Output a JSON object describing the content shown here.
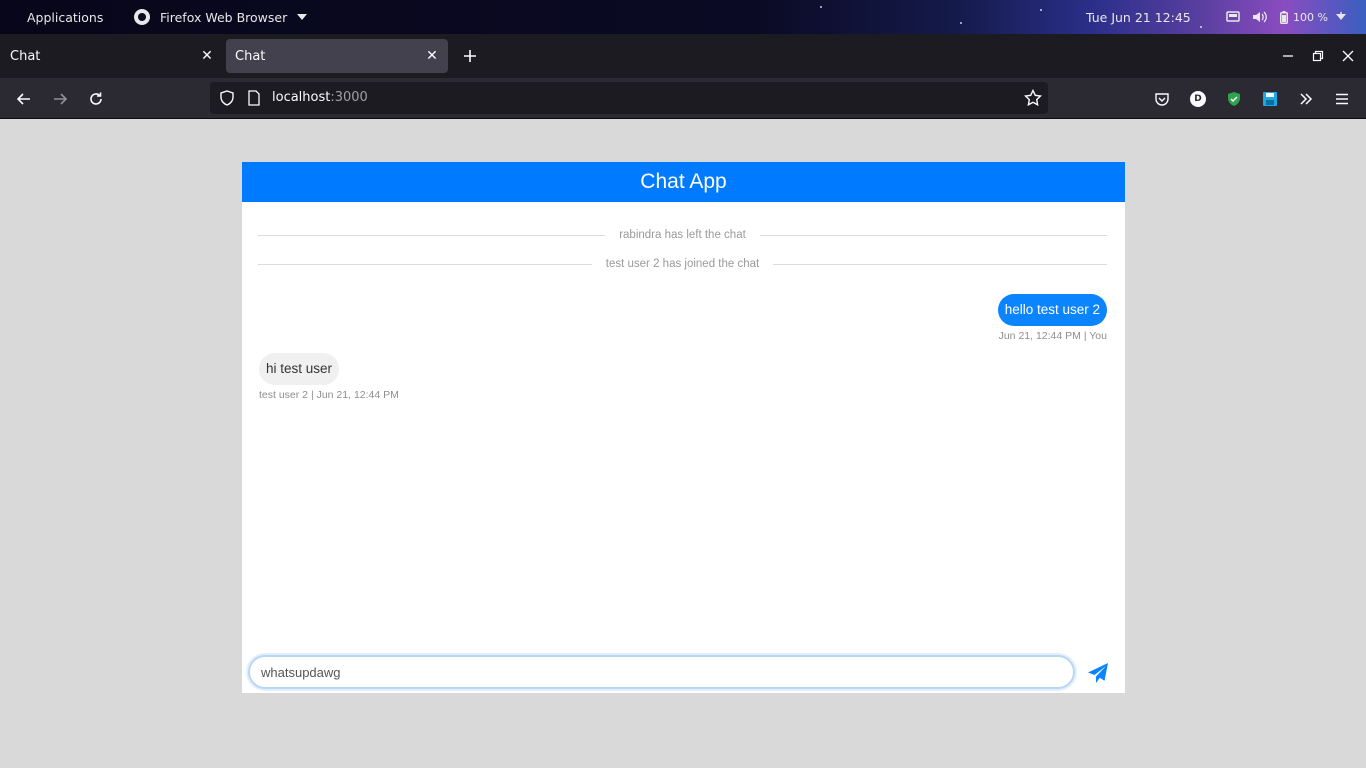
{
  "topbar": {
    "applications": "Applications",
    "app_name": "Firefox Web Browser",
    "clock": "Tue Jun 21  12:45",
    "battery": "100 %",
    "icons": [
      "screen-icon",
      "volume-icon",
      "battery-icon",
      "chevron-down-icon"
    ]
  },
  "tabs": [
    {
      "title": "Chat",
      "active": false
    },
    {
      "title": "Chat",
      "active": true
    }
  ],
  "nav": {
    "url_host": "localhost",
    "url_port": ":3000",
    "extensions": [
      "pocket-icon",
      "profile-icon",
      "shield-ext-icon",
      "save-ext-icon",
      "overflow-icon",
      "menu-icon"
    ],
    "profile_letter": "D"
  },
  "chat": {
    "title": "Chat App",
    "events": [
      {
        "text": "rabindra has left the chat"
      },
      {
        "text": "test user 2 has joined the chat"
      }
    ],
    "messages": [
      {
        "direction": "out",
        "text": "hello test user 2",
        "meta": "Jun 21, 12:44 PM | You"
      },
      {
        "direction": "in",
        "text": "hi test user",
        "meta": "test user 2 | Jun 21, 12:44 PM"
      }
    ],
    "input_value": "whatsupdawg"
  },
  "colors": {
    "header": "#007bff",
    "outgoing_bubble": "#0a84ff",
    "incoming_bubble": "#f0f0f0",
    "send_icon": "#0a84ff"
  }
}
